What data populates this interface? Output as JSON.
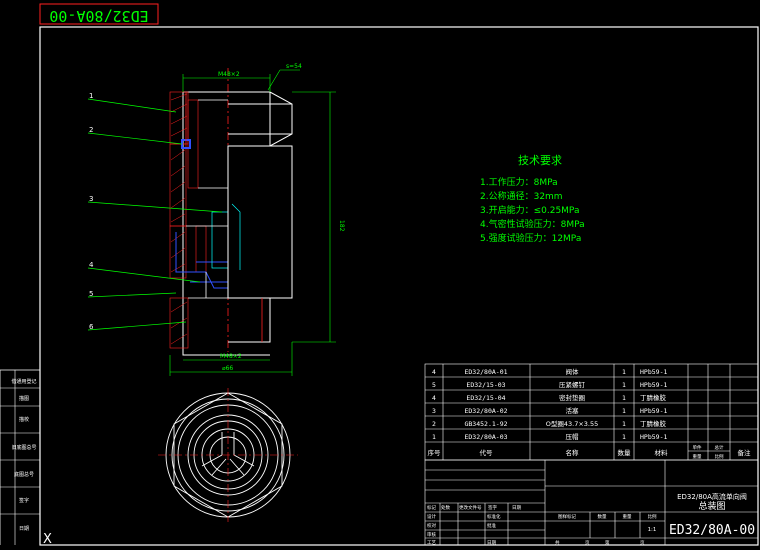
{
  "title_stamp": "ED32/80A-00",
  "dims": {
    "top_thread": "M48×2",
    "hex": "s=54",
    "height": "182",
    "bottom_thread": "M48×2",
    "diameter": "⌀66"
  },
  "callouts": [
    "1",
    "2",
    "3",
    "4",
    "5",
    "6"
  ],
  "tech": {
    "heading": "技术要求",
    "items": [
      "1.工作压力：8MPa",
      "2.公称通径：32mm",
      "3.开启能力：≤0.25MPa",
      "4.气密性试验压力：8MPa",
      "5.强度试验压力：12MPa"
    ]
  },
  "bom": {
    "rows": [
      {
        "no": "4",
        "code": "ED32/80A-01",
        "name": "阀体",
        "qty": "1",
        "mat": "HPb59-1"
      },
      {
        "no": "5",
        "code": "ED32/15-03",
        "name": "压紧螺钉",
        "qty": "1",
        "mat": "HPb59-1"
      },
      {
        "no": "4",
        "code": "ED32/15-04",
        "name": "密封垫圈",
        "qty": "1",
        "mat": "丁腈橡胶"
      },
      {
        "no": "3",
        "code": "ED32/80A-02",
        "name": "活塞",
        "qty": "1",
        "mat": "HPb59-1"
      },
      {
        "no": "2",
        "code": "GB3452.1-92",
        "name": "O型圈43.7×3.55",
        "qty": "1",
        "mat": "丁腈橡胶"
      },
      {
        "no": "1",
        "code": "ED32/80A-03",
        "name": "压帽",
        "qty": "1",
        "mat": "HPb59-1"
      }
    ],
    "header": {
      "no": "序号",
      "code": "代号",
      "name": "名称",
      "qty": "数量",
      "mat": "材料",
      "w1": "单件",
      "w2": "总计",
      "w3": "重量",
      "w4": "比例",
      "note": "备注"
    }
  },
  "title_block": {
    "product": "ED32/80A高流单向阀",
    "drawing_type": "总装图",
    "drawing_no": "ED32/80A-00",
    "scale": "1:1",
    "stage_mark": "图样标记",
    "weight": "重量",
    "qty": "数量",
    "ratio": "比例",
    "sheet_total": "共",
    "sheet_page": "页",
    "sheet_no": "第",
    "left_labels": [
      "标记",
      "处数",
      "更改文件号",
      "签字",
      "日期"
    ],
    "roles": [
      "设计",
      "校对",
      "审核",
      "工艺"
    ],
    "roles2": [
      "标准化",
      "批准",
      "日期"
    ]
  },
  "left_strip": [
    "借通用登记",
    "描图",
    "描校",
    "旧底图总号",
    "底图总号",
    "签字",
    "日期"
  ],
  "colors": {
    "red": "#ff2020",
    "green": "#00ff00",
    "cyan": "#00ffff",
    "blue": "#3050ff",
    "yellow": "#ffff00",
    "white": "#ffffff"
  }
}
